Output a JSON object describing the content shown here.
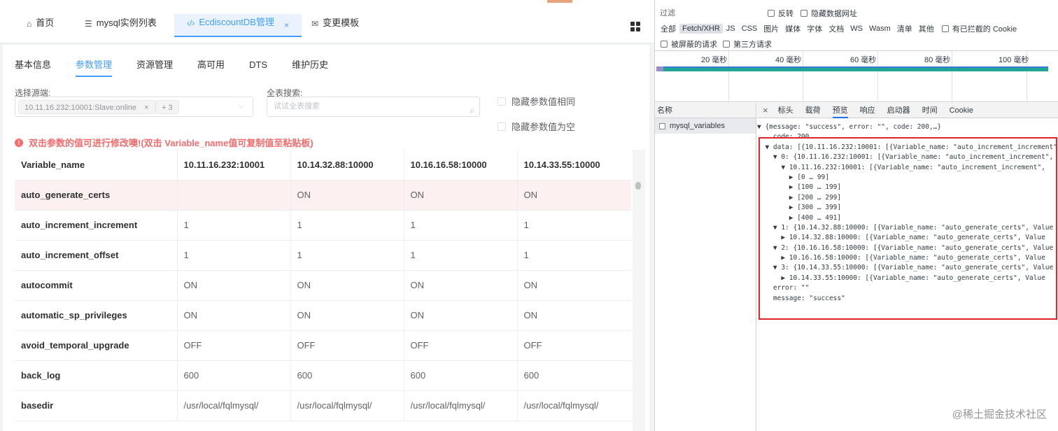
{
  "tabs": [
    {
      "icon": "home-icon",
      "label": "首页"
    },
    {
      "icon": "database-icon",
      "label": "mysql实例列表"
    },
    {
      "icon": "code-icon",
      "label": "EcdiscountDB管理",
      "close": "×"
    },
    {
      "icon": "template-icon",
      "label": "变更模板"
    }
  ],
  "subtabs": [
    "基本信息",
    "参数管理",
    "资源管理",
    "高可用",
    "DTS",
    "维护历史"
  ],
  "source": {
    "label": "选择源端:",
    "chip1": "10.11.16.232:10001:Slave:online",
    "chip1_close": "×",
    "chip2": "+ 3",
    "arrow": "⌵"
  },
  "search": {
    "label": "全表搜索:",
    "placeholder": "试试全表搜索",
    "icon": "⌕"
  },
  "options": [
    "隐藏参数值相同",
    "隐藏参数值为空"
  ],
  "warning": {
    "icon": "!",
    "text": "双击参数的值可进行修改噢!(双击 Variable_name值可复制值至粘贴板)"
  },
  "table": {
    "columns": [
      "Variable_name",
      "10.11.16.232:10001",
      "10.14.32.88:10000",
      "10.16.16.58:10000",
      "10.14.33.55:10000"
    ],
    "rows": [
      [
        "auto_generate_certs",
        "",
        "ON",
        "ON",
        "ON"
      ],
      [
        "auto_increment_increment",
        "1",
        "1",
        "1",
        "1"
      ],
      [
        "auto_increment_offset",
        "1",
        "1",
        "1",
        "1"
      ],
      [
        "autocommit",
        "ON",
        "ON",
        "ON",
        "ON"
      ],
      [
        "automatic_sp_privileges",
        "ON",
        "ON",
        "ON",
        "ON"
      ],
      [
        "avoid_temporal_upgrade",
        "OFF",
        "OFF",
        "OFF",
        "OFF"
      ],
      [
        "back_log",
        "600",
        "600",
        "600",
        "600"
      ],
      [
        "basedir",
        "/usr/local/fqlmysql/",
        "/usr/local/fqlmysql/",
        "/usr/local/fqlmysql/",
        "/usr/local/fqlmysql/"
      ]
    ]
  },
  "devtools": {
    "filter_placeholder": "过滤",
    "invert": "反转",
    "hide_data_urls": "隐藏数据网址",
    "types": [
      "全部",
      "Fetch/XHR",
      "JS",
      "CSS",
      "图片",
      "媒体",
      "字体",
      "文档",
      "WS",
      "Wasm",
      "清单",
      "其他"
    ],
    "blocked_cookies": "有已拦截的 Cookie",
    "blocked_requests": "被屏蔽的请求",
    "third_party": "第三方请求",
    "ticks": [
      "20 毫秒",
      "40 毫秒",
      "60 毫秒",
      "80 毫秒",
      "100 毫秒"
    ],
    "name_header": "名称",
    "request": "mysql_variables",
    "detail_tabs": [
      "标头",
      "载荷",
      "预览",
      "响应",
      "启动器",
      "时间",
      "Cookie"
    ],
    "close": "×"
  },
  "json_lines": [
    {
      "t": "▼ {message: \"success\", error: \"\", code: 200,…}"
    },
    {
      "t": "    code: 200"
    },
    {
      "t": "  ▼ data: [{10.11.16.232:10001: [{Variable_name: \"auto_increment_increment\","
    },
    {
      "t": "    ▼ 0: {10.11.16.232:10001: [{Variable_name: \"auto_increment_increment\","
    },
    {
      "t": "      ▼ 10.11.16.232:10001: [{Variable_name: \"auto_increment_increment\","
    },
    {
      "t": "        ▶ [0 … 99]"
    },
    {
      "t": "        ▶ [100 … 199]"
    },
    {
      "t": "        ▶ [200 … 299]"
    },
    {
      "t": "        ▶ [300 … 399]"
    },
    {
      "t": "        ▶ [400 … 491]"
    },
    {
      "t": "    ▼ 1: {10.14.32.88:10000: [{Variable_name: \"auto_generate_certs\", Value"
    },
    {
      "t": "      ▶ 10.14.32.88:10000: [{Variable_name: \"auto_generate_certs\", Value"
    },
    {
      "t": "    ▼ 2: {10.16.16.58:10000: [{Variable_name: \"auto_generate_certs\", Value"
    },
    {
      "t": "      ▶ 10.16.16.58:10000: [{Variable_name: \"auto_generate_certs\", Value"
    },
    {
      "t": "    ▼ 3: {10.14.33.55:10000: [{Variable_name: \"auto_generate_certs\", Value"
    },
    {
      "t": "      ▶ 10.14.33.55:10000: [{Variable_name: \"auto_generate_certs\", Value"
    },
    {
      "t": "    error: \"\""
    },
    {
      "t": "    message: \"success\""
    }
  ],
  "watermark": "@稀土掘金技术社区",
  "colors": {
    "accent": "#409eff",
    "warning": "#f56c6c",
    "highlight_row": "#fdf0f0",
    "red_box": "#e0252b"
  }
}
